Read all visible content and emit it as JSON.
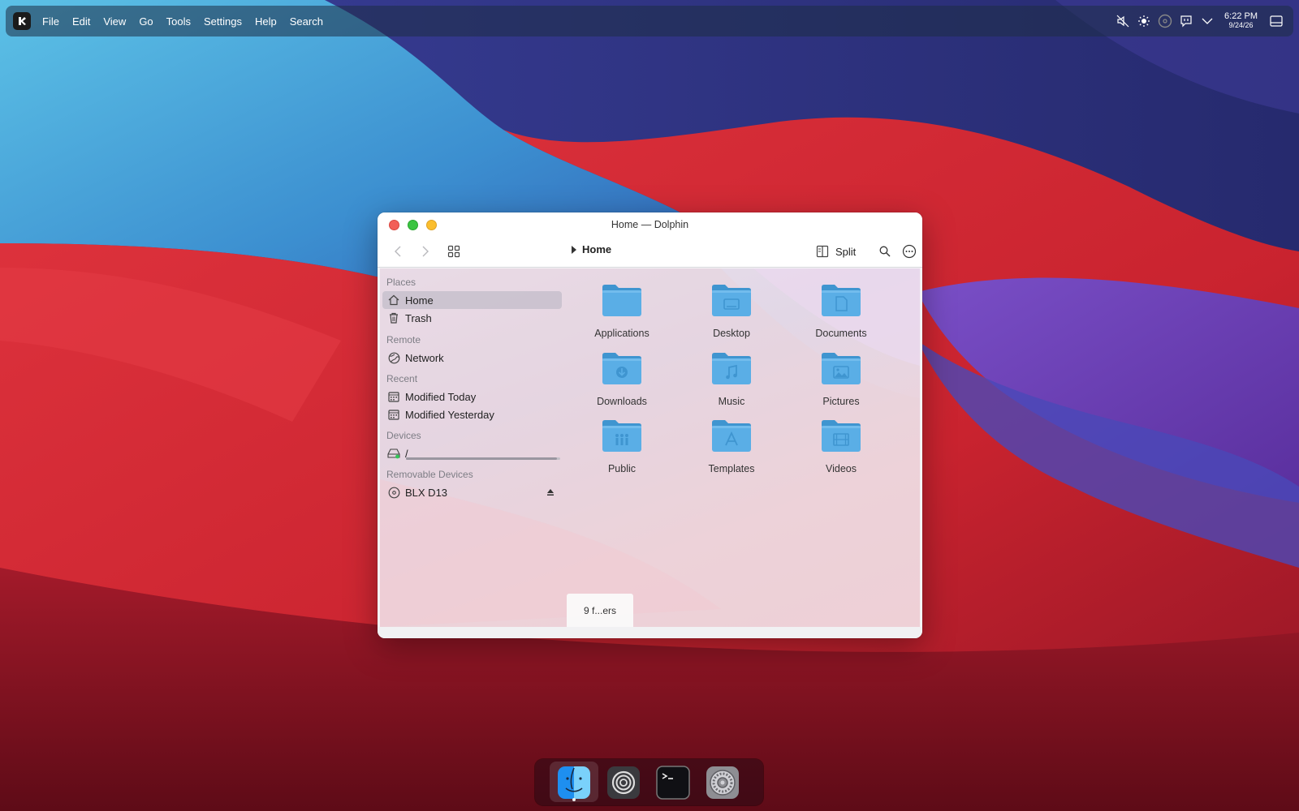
{
  "panel": {
    "menu": [
      "File",
      "Edit",
      "View",
      "Go",
      "Tools",
      "Settings",
      "Help",
      "Search"
    ],
    "tray_icons": [
      "speaker-muted-icon",
      "brightness-icon",
      "disc-icon",
      "chat-icon",
      "chevron-down-icon"
    ],
    "clock_time": "6:22 PM",
    "clock_date": "9/24/26",
    "show_desktop_icon": "show-desktop-icon"
  },
  "window": {
    "title": "Home — Dolphin",
    "breadcrumb": "Home",
    "split_label": "Split",
    "status": "9 f...ers"
  },
  "sidebar": {
    "places_label": "Places",
    "home": "Home",
    "trash": "Trash",
    "remote_label": "Remote",
    "network": "Network",
    "recent_label": "Recent",
    "modified_today": "Modified Today",
    "modified_yesterday": "Modified Yesterday",
    "devices_label": "Devices",
    "root": "/",
    "root_usage": 0.98,
    "removable_label": "Removable Devices",
    "blx": "BLX D13"
  },
  "folders": [
    {
      "name": "Applications",
      "icon": "applications-folder-icon"
    },
    {
      "name": "Desktop",
      "icon": "desktop-folder-icon"
    },
    {
      "name": "Documents",
      "icon": "documents-folder-icon"
    },
    {
      "name": "Downloads",
      "icon": "downloads-folder-icon"
    },
    {
      "name": "Music",
      "icon": "music-folder-icon"
    },
    {
      "name": "Pictures",
      "icon": "pictures-folder-icon"
    },
    {
      "name": "Public",
      "icon": "public-folder-icon"
    },
    {
      "name": "Templates",
      "icon": "templates-folder-icon"
    },
    {
      "name": "Videos",
      "icon": "videos-folder-icon"
    }
  ],
  "dock": [
    "finder-icon",
    "circular-app-icon",
    "terminal-icon",
    "system-settings-icon"
  ],
  "colors": {
    "folder": "#5aaee6",
    "folder_dark": "#3f95d0",
    "close": "#f25f58",
    "maximize": "#3bc441",
    "minimize": "#fbbe2e"
  }
}
